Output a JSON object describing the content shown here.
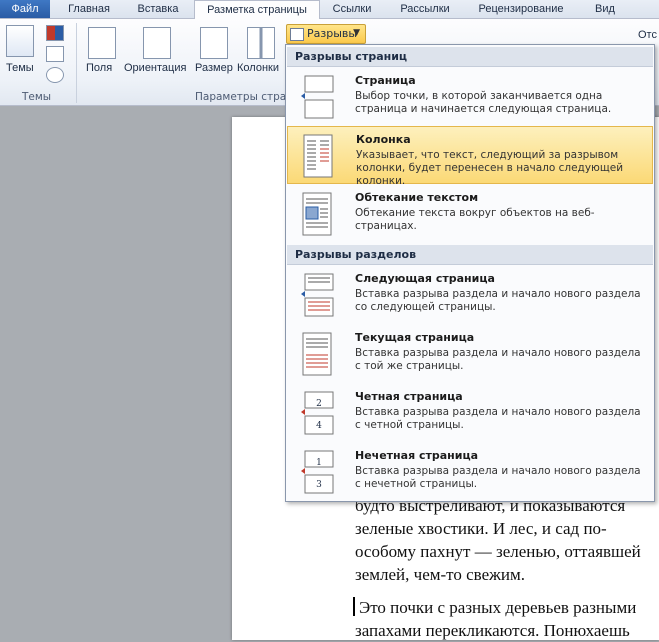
{
  "tabs": [
    "Файл",
    "Главная",
    "Вставка",
    "Разметка страницы",
    "Ссылки",
    "Рассылки",
    "Рецензирование",
    "Вид"
  ],
  "ribbon": {
    "themes_label": "Темы",
    "themes_group": "Темы",
    "fields_label": "Поля",
    "orientation_label": "Ориентация",
    "size_label": "Размер",
    "columns_label": "Колонки",
    "page_setup_group": "Параметры стран",
    "breaks_button": "Разрывы",
    "cut_label": "Отс"
  },
  "menu": {
    "page_breaks_header": "Разрывы страниц",
    "section_breaks_header": "Разрывы разделов",
    "items": [
      {
        "title": "Страница",
        "desc": "Выбор точки, в которой заканчивается одна страница и начинается следующая страница."
      },
      {
        "title": "Колонка",
        "desc": "Указывает, что текст, следующий за разрывом колонки, будет перенесен в начало следующей колонки."
      },
      {
        "title": "Обтекание текстом",
        "desc": "Обтекание текста вокруг объектов на веб-страницах."
      },
      {
        "title": "Следующая страница",
        "desc": "Вставка разрыва раздела и начало нового раздела со следующей страницы."
      },
      {
        "title": "Текущая страница",
        "desc": "Вставка разрыва раздела и начало нового раздела с той же страницы."
      },
      {
        "title": "Четная страница",
        "desc": "Вставка разрыва раздела и начало нового раздела с четной страницы."
      },
      {
        "title": "Нечетная страница",
        "desc": "Вставка разрыва раздела и начало нового раздела с нечетной страницы."
      }
    ]
  },
  "document": {
    "para1": [
      "будто выстреливают, и показываются",
      "зеленые хвостики. И лес, и сад по-",
      "особому пахнут — зеленью, оттаявшей",
      "землей, чем-то свежим."
    ],
    "para2": [
      "Это почки с разных деревьев разными",
      "запахами перекликаются. Понюхаешь"
    ]
  },
  "colors": {
    "accent": "#2a5ca5",
    "highlight": "#fbd976"
  }
}
